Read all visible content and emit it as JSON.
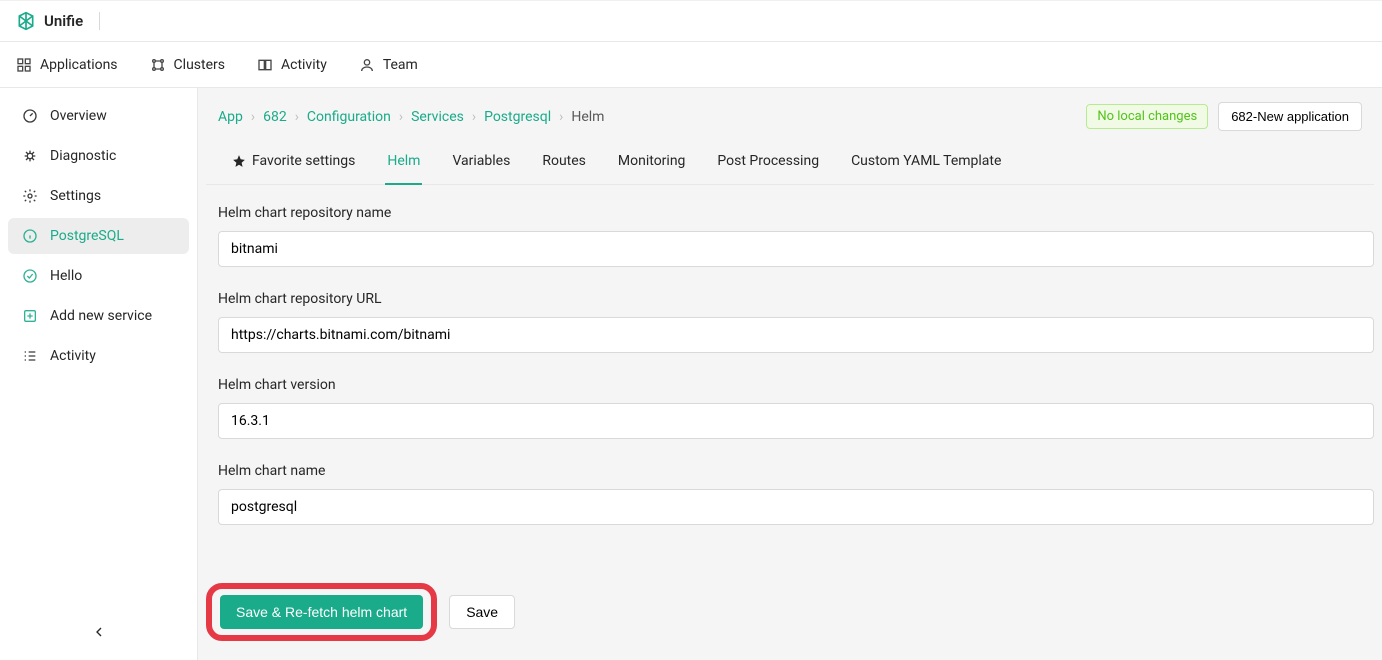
{
  "brand": "Unifie",
  "nav": {
    "applications": "Applications",
    "clusters": "Clusters",
    "activity": "Activity",
    "team": "Team"
  },
  "sidebar": {
    "overview": "Overview",
    "diagnostic": "Diagnostic",
    "settings": "Settings",
    "postgresql": "PostgreSQL",
    "hello": "Hello",
    "add_new_service": "Add new service",
    "activity": "Activity"
  },
  "breadcrumb": {
    "app": "App",
    "id": "682",
    "configuration": "Configuration",
    "services": "Services",
    "service": "Postgresql",
    "page": "Helm"
  },
  "header_right": {
    "badge": "No local changes",
    "app_button": "682-New application"
  },
  "tabs": {
    "favorite": "Favorite settings",
    "helm": "Helm",
    "variables": "Variables",
    "routes": "Routes",
    "monitoring": "Monitoring",
    "post_processing": "Post Processing",
    "custom_yaml": "Custom YAML Template"
  },
  "form": {
    "repo_name_label": "Helm chart repository name",
    "repo_name_value": "bitnami",
    "repo_url_label": "Helm chart repository URL",
    "repo_url_value": "https://charts.bitnami.com/bitnami",
    "version_label": "Helm chart version",
    "version_value": "16.3.1",
    "chart_name_label": "Helm chart name",
    "chart_name_value": "postgresql"
  },
  "actions": {
    "save_refetch": "Save & Re-fetch helm chart",
    "save": "Save"
  }
}
